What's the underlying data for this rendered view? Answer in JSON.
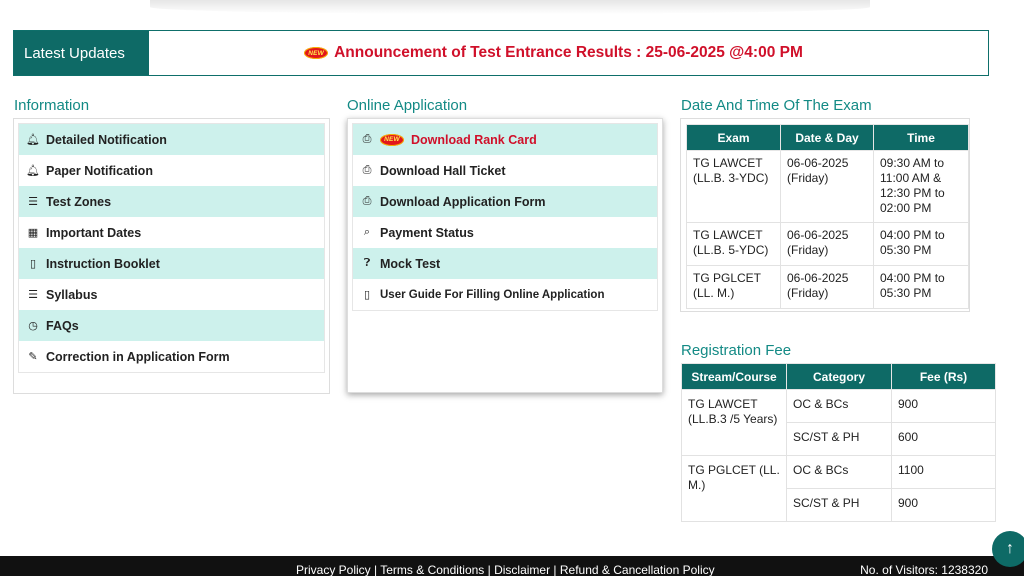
{
  "latest_updates": {
    "label": "Latest Updates",
    "badge": "NEW",
    "announcement": "Announcement of Test Entrance Results : 25-06-2025 @4:00 PM"
  },
  "information": {
    "title": "Information",
    "items": [
      {
        "label": "Detailed Notification",
        "icon": "bell-icon"
      },
      {
        "label": "Paper Notification",
        "icon": "bell-icon"
      },
      {
        "label": "Test Zones",
        "icon": "list-icon"
      },
      {
        "label": "Important Dates",
        "icon": "calendar-icon"
      },
      {
        "label": "Instruction Booklet",
        "icon": "file-icon"
      },
      {
        "label": "Syllabus",
        "icon": "list-icon"
      },
      {
        "label": "FAQs",
        "icon": "clock-icon"
      },
      {
        "label": "Correction in Application Form",
        "icon": "edit-icon"
      }
    ]
  },
  "online_application": {
    "title": "Online Application",
    "items": [
      {
        "label": "Download Rank Card",
        "icon": "printer-icon",
        "badge": "NEW"
      },
      {
        "label": "Download Hall Ticket",
        "icon": "printer-icon"
      },
      {
        "label": "Download Application Form",
        "icon": "printer-icon"
      },
      {
        "label": "Payment Status",
        "icon": "search-icon"
      },
      {
        "label": "Mock Test",
        "icon": "question-icon"
      },
      {
        "label": "User Guide For Filling Online Application",
        "icon": "file-icon"
      }
    ]
  },
  "exam_schedule": {
    "title": "Date And Time Of The Exam",
    "headers": [
      "Exam",
      "Date & Day",
      "Time"
    ],
    "rows": [
      {
        "exam": "TG LAWCET (LL.B. 3-YDC)",
        "date": "06-06-2025 (Friday)",
        "time": "09:30 AM to 11:00 AM & 12:30 PM to 02:00 PM"
      },
      {
        "exam": "TG LAWCET (LL.B. 5-YDC)",
        "date": "06-06-2025 (Friday)",
        "time": "04:00 PM to 05:30 PM"
      },
      {
        "exam": "TG PGLCET (LL. M.)",
        "date": "06-06-2025 (Friday)",
        "time": "04:00 PM to 05:30 PM"
      }
    ]
  },
  "registration_fee": {
    "title": "Registration Fee",
    "headers": [
      "Stream/Course",
      "Category",
      "Fee (Rs)"
    ],
    "rows": [
      {
        "course": "TG LAWCET (LL.B.3 /5 Years)",
        "cat1": "OC & BCs",
        "fee1": "900",
        "cat2": "SC/ST & PH",
        "fee2": "600"
      },
      {
        "course": "TG PGLCET (LL. M.)",
        "cat1": "OC & BCs",
        "fee1": "1100",
        "cat2": "SC/ST & PH",
        "fee2": "900"
      }
    ]
  },
  "footer": {
    "links": "Privacy Policy | Terms & Conditions | Disclaimer | Refund & Cancellation Policy",
    "visitors": "No. of Visitors: 1238320"
  },
  "scroll_top_icon": "arrow-up-icon"
}
